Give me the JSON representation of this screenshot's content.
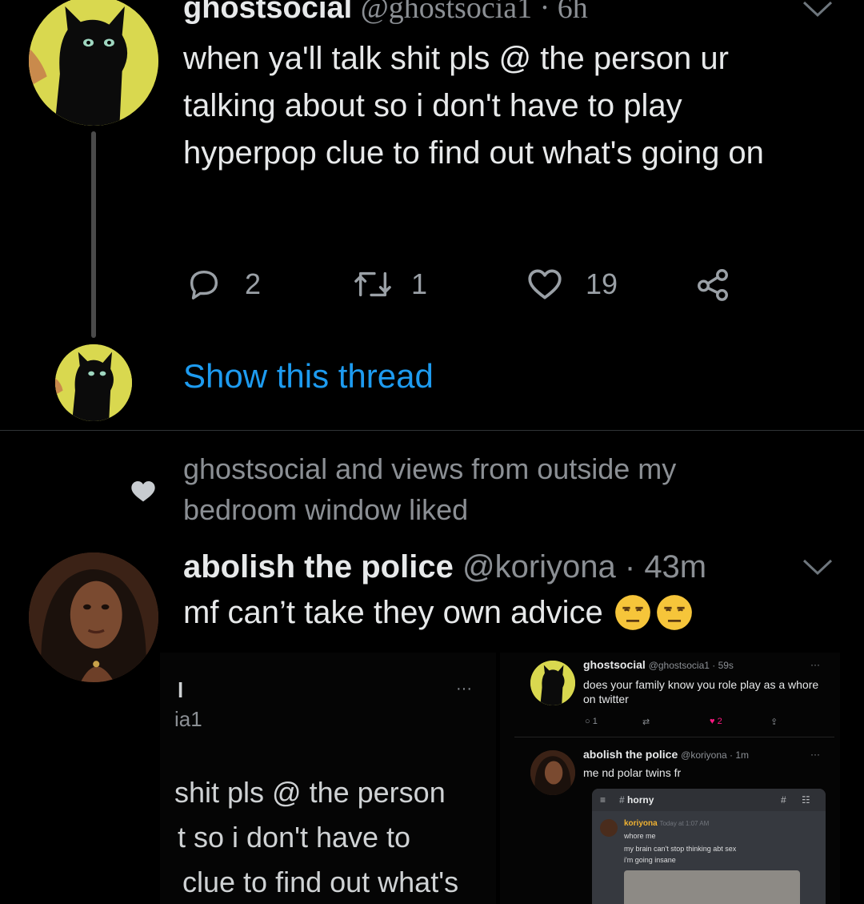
{
  "tweet1": {
    "display_name": "ghostsocial",
    "handle_time": "@ghostsocia1 · 6h",
    "text": "when ya'll talk shit pls @ the person ur talking about so i don't have to play hyperpop clue to find out what's going on",
    "reply_count": "2",
    "retweet_count": "1",
    "like_count": "19"
  },
  "thread": {
    "show_label": "Show this thread"
  },
  "social_context": {
    "text": "ghostsocial and views from outside my bedroom window liked"
  },
  "tweet2": {
    "display_name": "abolish the police",
    "handle_time": "@koriyona · 43m",
    "text": "mf can’t take they own advice"
  },
  "embedded_image": {
    "left_fragments": {
      "name_frag": "l",
      "handle_frag": "ia1",
      "dots": "···",
      "line1": "shit pls @ the person",
      "line2": "t so i don't have to",
      "line3": "clue to find out what's"
    },
    "mini_tweet1": {
      "name": "ghostsocial",
      "meta": "@ghostsocia1 · 59s",
      "dots": "···",
      "text": "does your family know you role play as a whore on twitter",
      "reply_count": "1",
      "like_count": "2"
    },
    "mini_tweet2": {
      "name": "abolish the police",
      "meta": "@koriyona · 1m",
      "dots": "···",
      "text": "me nd polar twins fr"
    },
    "discord": {
      "channel": "horny",
      "user": "koriyona",
      "time": "Today at 1:07 AM",
      "line1": "whore me",
      "line2": "my brain can't stop thinking abt sex",
      "line3": "i'm going insane"
    }
  },
  "colors": {
    "link": "#1d9bf0",
    "muted": "#8b8f94",
    "background": "#000000",
    "like_red": "#f91880"
  },
  "icons": [
    "reply-icon",
    "retweet-icon",
    "like-icon",
    "share-icon",
    "chevron-down-icon",
    "heart-icon",
    "unamused-emoji"
  ]
}
